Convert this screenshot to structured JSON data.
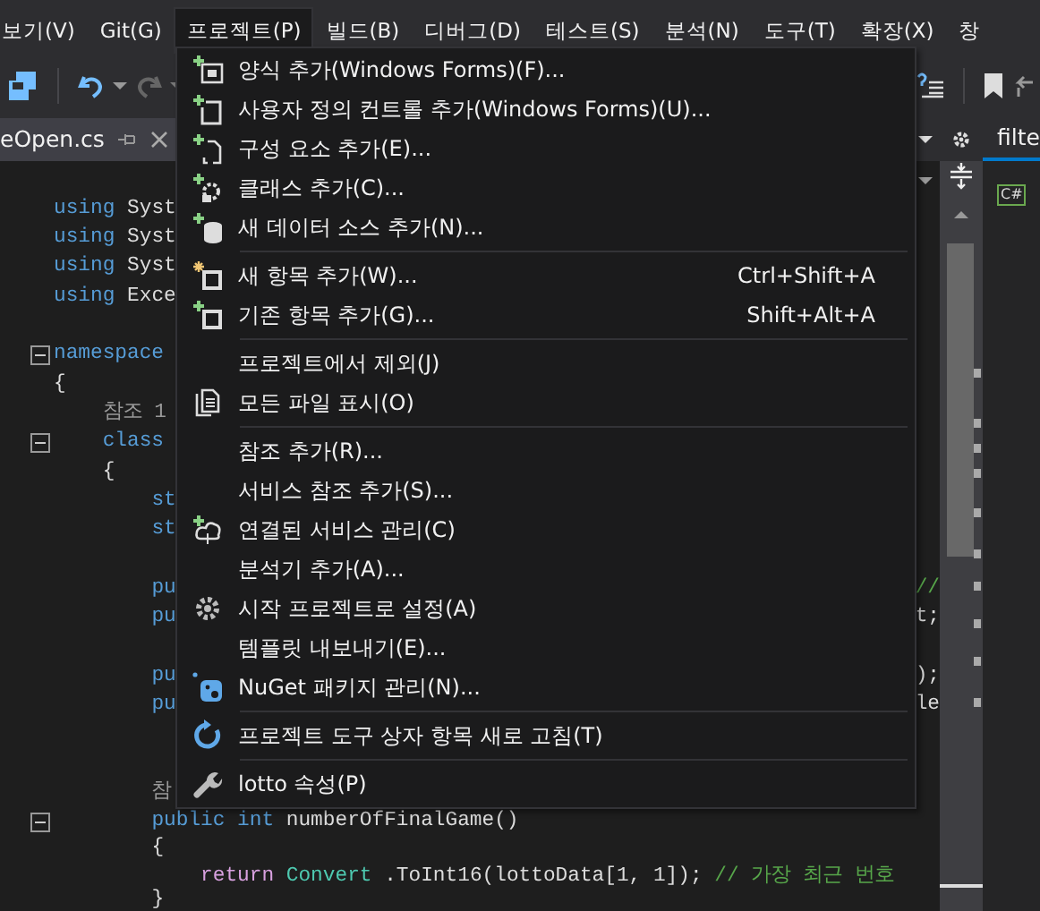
{
  "menubar": [
    {
      "label": "보기(V)",
      "selected": false
    },
    {
      "label": "Git(G)",
      "selected": false
    },
    {
      "label": "프로젝트(P)",
      "selected": true
    },
    {
      "label": "빌드(B)",
      "selected": false
    },
    {
      "label": "디버그(D)",
      "selected": false
    },
    {
      "label": "테스트(S)",
      "selected": false
    },
    {
      "label": "분석(N)",
      "selected": false
    },
    {
      "label": "도구(T)",
      "selected": false
    },
    {
      "label": "확장(X)",
      "selected": false
    },
    {
      "label": "창",
      "selected": false
    }
  ],
  "document_tab": {
    "label": "eOpen.cs",
    "selected": true
  },
  "side_panel": {
    "tab": "filte",
    "file_icon_label": "C#"
  },
  "menu": {
    "items": [
      {
        "kind": "item",
        "label": "양식 추가(Windows Forms)(F)..."
      },
      {
        "kind": "item",
        "label": "사용자 정의 컨트롤 추가(Windows Forms)(U)..."
      },
      {
        "kind": "item",
        "label": "구성 요소 추가(E)..."
      },
      {
        "kind": "item",
        "label": "클래스 추가(C)..."
      },
      {
        "kind": "item",
        "label": "새 데이터 소스 추가(N)..."
      },
      {
        "kind": "separator"
      },
      {
        "kind": "item",
        "label": "새 항목 추가(W)...",
        "shortcut": "Ctrl+Shift+A"
      },
      {
        "kind": "item",
        "label": "기존 항목 추가(G)...",
        "shortcut": "Shift+Alt+A"
      },
      {
        "kind": "separator"
      },
      {
        "kind": "item",
        "label": "프로젝트에서 제외(J)"
      },
      {
        "kind": "item",
        "label": "모든 파일 표시(O)"
      },
      {
        "kind": "separator"
      },
      {
        "kind": "item",
        "label": "참조 추가(R)..."
      },
      {
        "kind": "item",
        "label": "서비스 참조 추가(S)..."
      },
      {
        "kind": "item",
        "label": "연결된 서비스 관리(C)"
      },
      {
        "kind": "item",
        "label": "분석기 추가(A)..."
      },
      {
        "kind": "item",
        "label": "시작 프로젝트로 설정(A)"
      },
      {
        "kind": "item",
        "label": "템플릿 내보내기(E)..."
      },
      {
        "kind": "item",
        "label": "NuGet 패키지 관리(N)..."
      },
      {
        "kind": "separator"
      },
      {
        "kind": "item",
        "label": "프로젝트 도구 상자 항목 새로 고침(T)"
      },
      {
        "kind": "separator"
      },
      {
        "kind": "item",
        "label": "lotto 속성(P)"
      }
    ]
  },
  "code": {
    "lines": [
      {
        "kind": "code",
        "tokens": [
          {
            "text": "using",
            "kind": "keyword"
          },
          {
            "text": "Syst",
            "kind": "plain"
          }
        ]
      },
      {
        "kind": "code",
        "tokens": [
          {
            "text": "using",
            "kind": "keyword"
          },
          {
            "text": "Syst",
            "kind": "plain"
          }
        ]
      },
      {
        "kind": "code",
        "tokens": [
          {
            "text": "using",
            "kind": "keyword"
          },
          {
            "text": "Syst",
            "kind": "plain"
          }
        ]
      },
      {
        "kind": "code",
        "tokens": [
          {
            "text": "using",
            "kind": "keyword"
          },
          {
            "text": "Exce",
            "kind": "plain"
          }
        ]
      },
      {
        "kind": "blank"
      },
      {
        "kind": "code",
        "expanded": true,
        "tokens": [
          {
            "text": "namespace",
            "kind": "keyword"
          }
        ]
      },
      {
        "kind": "code",
        "tokens": [
          {
            "text": "{",
            "kind": "plain"
          }
        ]
      },
      {
        "kind": "code",
        "tokens": [
          {
            "text": "    참조 1",
            "kind": "lens"
          }
        ]
      },
      {
        "kind": "code",
        "expanded": true,
        "tokens": [
          {
            "text": "    class",
            "kind": "keyword"
          }
        ]
      },
      {
        "kind": "code",
        "tokens": [
          {
            "text": "    {",
            "kind": "plain"
          }
        ]
      },
      {
        "kind": "code",
        "tokens": [
          {
            "text": "        st",
            "kind": "keyword"
          }
        ]
      },
      {
        "kind": "code",
        "tokens": [
          {
            "text": "        st",
            "kind": "keyword"
          }
        ]
      },
      {
        "kind": "blank"
      },
      {
        "kind": "code",
        "tokens": [
          {
            "text": "        pu",
            "kind": "keyword"
          }
        ],
        "right": [
          {
            "text": "//",
            "kind": "comment"
          }
        ]
      },
      {
        "kind": "code",
        "tokens": [
          {
            "text": "        pu",
            "kind": "keyword"
          }
        ],
        "right": [
          {
            "text": "t;",
            "kind": "plain"
          }
        ]
      },
      {
        "kind": "blank"
      },
      {
        "kind": "code",
        "tokens": [
          {
            "text": "        pu",
            "kind": "keyword"
          }
        ],
        "right": [
          {
            "text": ");",
            "kind": "plain"
          }
        ]
      },
      {
        "kind": "code",
        "tokens": [
          {
            "text": "        pu",
            "kind": "keyword"
          }
        ],
        "right": [
          {
            "text": "le",
            "kind": "plain"
          }
        ]
      },
      {
        "kind": "blank"
      },
      {
        "kind": "blank"
      },
      {
        "kind": "code",
        "tokens": [
          {
            "text": "        참",
            "kind": "lens"
          }
        ]
      },
      {
        "kind": "code",
        "expanded": true,
        "tokens": [
          {
            "text": "        public int",
            "kind": "keyword"
          },
          {
            "text": "numberOfFinalGame()",
            "kind": "plain"
          }
        ]
      },
      {
        "kind": "code",
        "tokens": [
          {
            "text": "        {",
            "kind": "plain"
          }
        ]
      },
      {
        "kind": "code",
        "tokens": [
          {
            "text": "            return",
            "kind": "control"
          },
          {
            "text": "Convert",
            "kind": "type"
          },
          {
            "text": ".ToInt16(lottoData[1, 1]);",
            "kind": "plain"
          },
          {
            "text": "// 가장 최근 번호",
            "kind": "comment"
          }
        ]
      },
      {
        "kind": "code",
        "tokens": [
          {
            "text": "        }",
            "kind": "plain"
          }
        ]
      }
    ]
  }
}
